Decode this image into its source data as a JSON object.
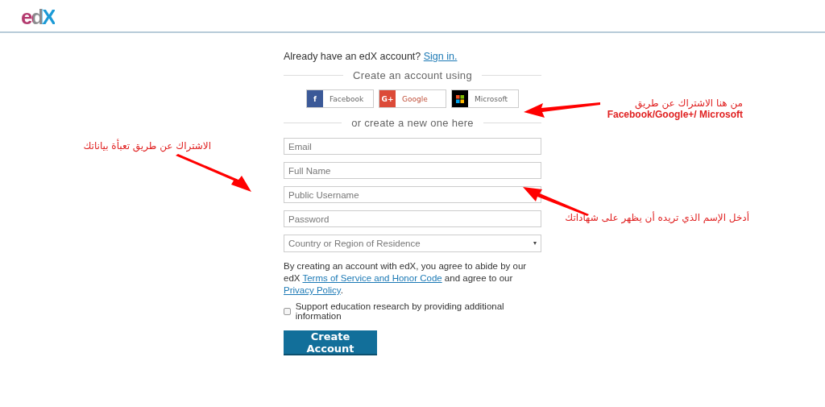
{
  "header": {
    "logo": "edX"
  },
  "signin": {
    "prompt": "Already have an edX account?",
    "link": "Sign in."
  },
  "social_heading": "Create an account using",
  "social_buttons": [
    {
      "kind": "facebook",
      "icon": "f",
      "label": "Facebook"
    },
    {
      "kind": "google",
      "icon": "G+",
      "label": "Google"
    },
    {
      "kind": "microsoft",
      "label": "Microsoft"
    }
  ],
  "new_heading": "or create a new one here",
  "fields": [
    {
      "kind": "text",
      "placeholder": "Email"
    },
    {
      "kind": "text",
      "placeholder": "Full Name"
    },
    {
      "kind": "text",
      "placeholder": "Public Username"
    },
    {
      "kind": "password",
      "placeholder": "Password"
    },
    {
      "kind": "select",
      "placeholder": "Country or Region of Residence"
    }
  ],
  "terms": [
    {
      "kind": "text",
      "text": "By creating an account with edX, you agree to abide by our edX "
    },
    {
      "kind": "link",
      "text": "Terms of Service and Honor Code"
    },
    {
      "kind": "text",
      "text": " and agree to our "
    },
    {
      "kind": "link",
      "text": "Privacy Policy"
    },
    {
      "kind": "text",
      "text": "."
    }
  ],
  "research_checkbox": {
    "label": "Support education research by providing additional information",
    "checked": false
  },
  "submit": "Create Account",
  "annotations": [
    {
      "lines": [
        "من هنا الاشتراك عن طريق",
        "Facebook/Google+/ Microsoft"
      ]
    },
    {
      "lines": [
        "الاشتراك عن طريق تعبأة بياناتك"
      ]
    },
    {
      "lines": [
        "أدخل الإسم الذي تريده أن يظهر على شهاداتك"
      ]
    }
  ]
}
